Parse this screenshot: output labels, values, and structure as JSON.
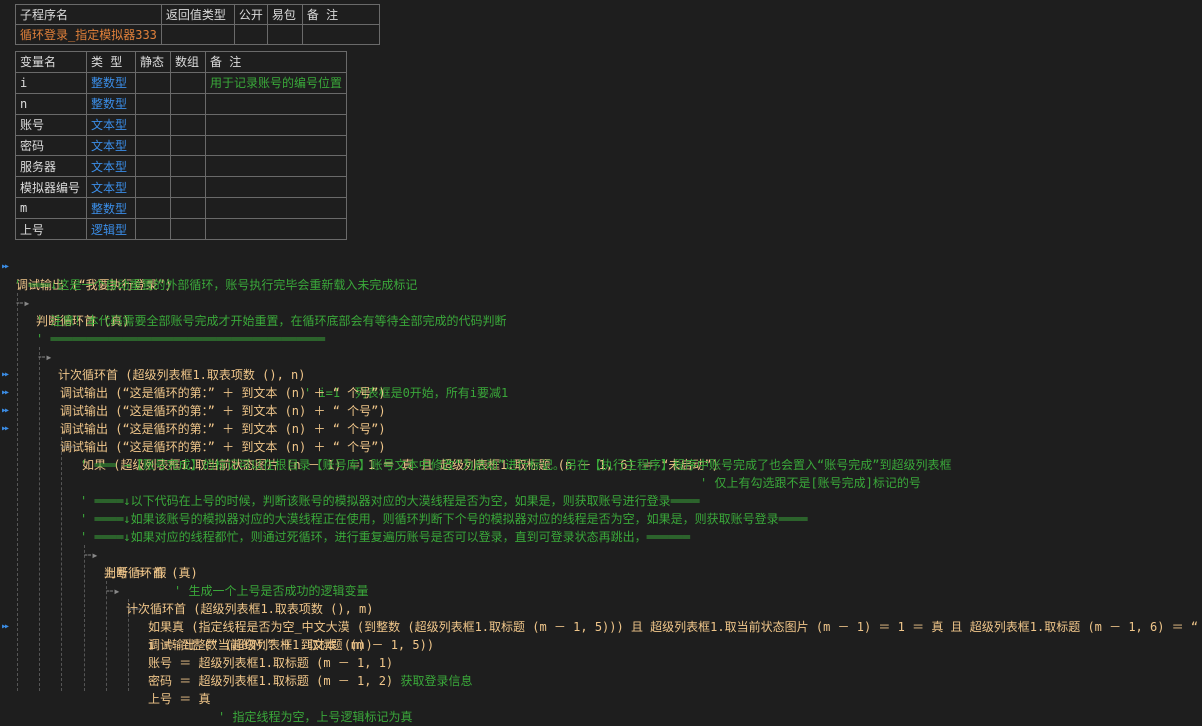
{
  "sub_table": {
    "headers": [
      "子程序名",
      "返回值类型",
      "公开",
      "易包",
      "备 注"
    ],
    "row": [
      "循环登录_指定模拟器333",
      "",
      "",
      "",
      ""
    ]
  },
  "var_table": {
    "headers": [
      "变量名",
      "类 型",
      "静态",
      "数组",
      "备 注"
    ],
    "rows": [
      [
        "i",
        "整数型",
        "",
        "",
        "用于记录账号的编号位置"
      ],
      [
        "n",
        "整数型",
        "",
        "",
        ""
      ],
      [
        "账号",
        "文本型",
        "",
        "",
        ""
      ],
      [
        "密码",
        "文本型",
        "",
        "",
        ""
      ],
      [
        "服务器",
        "文本型",
        "",
        "",
        ""
      ],
      [
        "模拟器编号",
        "文本型",
        "",
        "",
        ""
      ],
      [
        "m",
        "整数型",
        "",
        "",
        ""
      ],
      [
        "上号",
        "逻辑型",
        "",
        "",
        ""
      ]
    ]
  },
  "code_lines": [
    "调试输出 (“我要执行登录”)",
    "' ═══↓这是一个自动重置的外部循环，账号执行完毕会重新载入未完成标记",
    "判断循环首 (真)",
    "' 注意！本代码需要全部账号完成才开始重置，在循环底部会有等待全部完成的代码判断",
    "' ══════════════════════════════════════",
    "计次循环首 (超级列表框1.取表项数 (), n)",
    "' i=1  列表框是0开始，所有i要减1",
    "调试输出 (“这是循环的第：” ＋ 到文本 (n) ＋ “ 个号”)",
    "调试输出 (“这是循环的第：” ＋ 到文本 (n) ＋ “ 个号”)",
    "调试输出 (“这是循环的第：” ＋ 到文本 (n) ＋ “ 个号”)",
    "调试输出 (“这是循环的第：” ＋ 到文本 (n) ＋ “ 个号”)",
    "如果 (超级列表框1.取当前状态图片 (n － 1) ＝ 1 ＝ 真 且 超级列表框1.取标题 (n － 1, 6) ＝ “未启动”)",
    "' 仅上有勾选跟不是[账号完成]标记的号",
    "' ═══ →【账号完成】的标记可以在根目录【账号库】账号文本中修改“为启动”进行标记。另在【执行主程序】程序中账号完成了也会置入“账号完成”到超级列表框",
    "' ════↓以下代码在上号的时候，判断该账号的模拟器对应的大漠线程是否为空，如果是，则获取账号进行登录════",
    "' ════↓如果该账号的模拟器对应的大漠线程正在使用，则循环判断下个号的模拟器对应的线程是否为空，如果是，则获取账号登录════",
    "' ════↓如果对应的线程都忙，则通过死循环，进行重复遍历账号是否可以登录，直到可登录状态再跳出，══════",
    "判断循环首 (真)",
    "上号 ＝ 假",
    "' 生成一个上号是否成功的逻辑变量",
    "计次循环首 (超级列表框1.取表项数 (), m)",
    "如果真 (指定线程是否为空_中文大漠 (到整数 (超级列表框1.取标题 (m － 1, 5))) 且 超级列表框1.取当前状态图片 (m － 1) ＝ 1 ＝ 真 且 超级列表框1.取标题 (m － 1, 6) ＝ “未启动”)",
    "调试输出 (“当前的M：” ＋ 到文本 (m))",
    "i ＝ 到整数 (超级列表框1.取标题 (m － 1, 5))",
    "账号 ＝ 超级列表框1.取标题 (m － 1, 1)",
    "' 获取登录信息",
    "密码 ＝ 超级列表框1.取标题 (m － 1, 2)",
    "上号 ＝ 真",
    "' 指定线程为空，上号逻辑标记为真"
  ]
}
